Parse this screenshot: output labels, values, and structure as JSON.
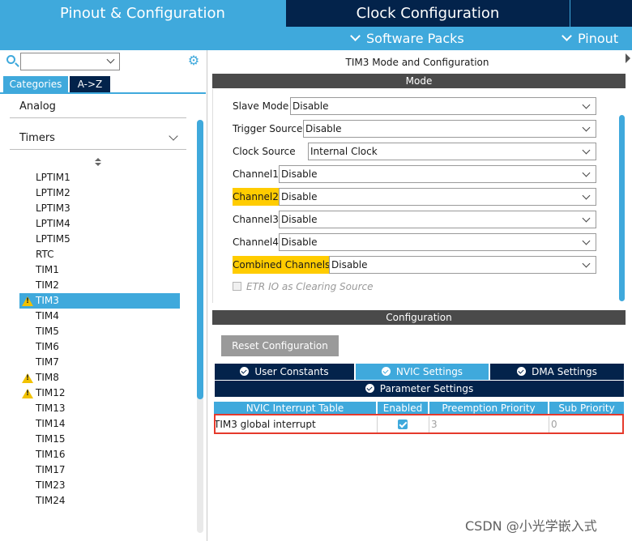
{
  "top_tabs": {
    "pinout_config": "Pinout & Configuration",
    "clock_config": "Clock Configuration"
  },
  "sub_nav": {
    "software_packs": "Software Packs",
    "pinout": "Pinout"
  },
  "left_panel": {
    "tabs": {
      "categories": "Categories",
      "az": "A->Z"
    },
    "groups": {
      "analog": "Analog",
      "timers": "Timers"
    },
    "timers": [
      {
        "label": "LPTIM1",
        "warning": false
      },
      {
        "label": "LPTIM2",
        "warning": false
      },
      {
        "label": "LPTIM3",
        "warning": false
      },
      {
        "label": "LPTIM4",
        "warning": false
      },
      {
        "label": "LPTIM5",
        "warning": false
      },
      {
        "label": "RTC",
        "warning": false
      },
      {
        "label": "TIM1",
        "warning": false
      },
      {
        "label": "TIM2",
        "warning": false
      },
      {
        "label": "TIM3",
        "warning": true,
        "selected": true
      },
      {
        "label": "TIM4",
        "warning": false
      },
      {
        "label": "TIM5",
        "warning": false
      },
      {
        "label": "TIM6",
        "warning": false
      },
      {
        "label": "TIM7",
        "warning": false
      },
      {
        "label": "TIM8",
        "warning": true
      },
      {
        "label": "TIM12",
        "warning": true
      },
      {
        "label": "TIM13",
        "warning": false
      },
      {
        "label": "TIM14",
        "warning": false
      },
      {
        "label": "TIM15",
        "warning": false
      },
      {
        "label": "TIM16",
        "warning": false
      },
      {
        "label": "TIM17",
        "warning": false
      },
      {
        "label": "TIM23",
        "warning": false
      },
      {
        "label": "TIM24",
        "warning": false
      }
    ]
  },
  "mode": {
    "title": "TIM3 Mode and Configuration",
    "section": "Mode",
    "fields": {
      "slave_mode": {
        "label": "Slave Mode",
        "value": "Disable"
      },
      "trigger_source": {
        "label": "Trigger Source",
        "value": "Disable"
      },
      "clock_source": {
        "label": "Clock Source",
        "value": "Internal Clock"
      },
      "channel1": {
        "label": "Channel1",
        "value": "Disable"
      },
      "channel2": {
        "label": "Channel2",
        "value": "Disable"
      },
      "channel3": {
        "label": "Channel3",
        "value": "Disable"
      },
      "channel4": {
        "label": "Channel4",
        "value": "Disable"
      },
      "combined_channels": {
        "label": "Combined Channels",
        "value": "Disable"
      }
    },
    "etr_label": "ETR IO as Clearing Source"
  },
  "configuration": {
    "section": "Configuration",
    "reset_button": "Reset Configuration",
    "tabs": {
      "user_constants": "User Constants",
      "nvic_settings": "NVIC Settings",
      "dma_settings": "DMA Settings",
      "parameter_settings": "Parameter Settings"
    },
    "table": {
      "headers": [
        "NVIC Interrupt Table",
        "Enabled",
        "Preemption Priority",
        "Sub Priority"
      ],
      "rows": [
        {
          "name": "TIM3 global interrupt",
          "enabled": true,
          "preemption": "3",
          "sub": "0"
        }
      ]
    }
  },
  "watermark": "CSDN @小光学嵌入式",
  "colors": {
    "accent": "#3fa9dc",
    "navy": "#03234b",
    "highlight": "#ffcc00",
    "frame": "#e53a2c"
  }
}
